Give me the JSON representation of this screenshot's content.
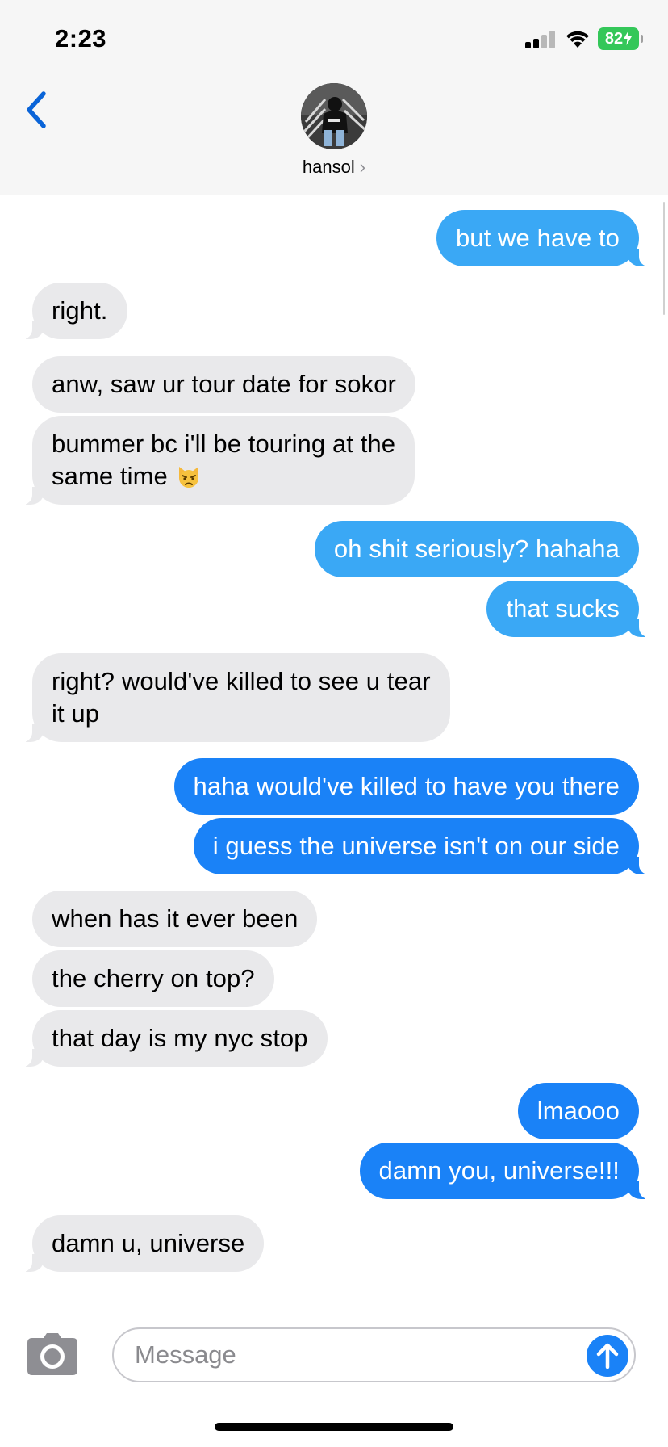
{
  "status_bar": {
    "time": "2:23",
    "battery": "82"
  },
  "header": {
    "back_icon": "chevron-left-icon",
    "contact_name": "hansol",
    "contact_chevron": "›"
  },
  "colors": {
    "incoming_bubble": "#e9e9eb",
    "outgoing_bubble_light": "#3aa8f5",
    "outgoing_bubble_dark": "#1a82f7",
    "accent": "#007aff",
    "battery": "#34c759"
  },
  "messages": [
    {
      "from": "me",
      "text": "but we have to",
      "tail": true
    },
    {
      "from": "them",
      "text": "right.",
      "tail": true
    },
    {
      "from": "them",
      "text": "anw, saw ur tour date for sokor",
      "tail": false
    },
    {
      "from": "them",
      "text": "bummer bc i'll be touring at the\nsame time",
      "emoji": "pouting-cat-emoji",
      "tail": true
    },
    {
      "from": "me",
      "text": "oh shit seriously? hahaha",
      "tail": false
    },
    {
      "from": "me",
      "text": "that sucks",
      "tail": true
    },
    {
      "from": "them",
      "text": "right? would've killed to see u tear\nit up",
      "tail": true
    },
    {
      "from": "me",
      "text": "haha would've killed to have you there",
      "tail": false
    },
    {
      "from": "me",
      "text": "i guess the universe isn't on our side",
      "tail": true
    },
    {
      "from": "them",
      "text": "when has it ever been",
      "tail": false
    },
    {
      "from": "them",
      "text": "the cherry on top?",
      "tail": false
    },
    {
      "from": "them",
      "text": "that day is my nyc stop",
      "tail": true
    },
    {
      "from": "me",
      "text": "lmaooo",
      "tail": false
    },
    {
      "from": "me",
      "text": "damn you, universe!!!",
      "tail": true
    },
    {
      "from": "them",
      "text": "damn u, universe",
      "tail": true
    }
  ],
  "composer": {
    "camera_icon": "camera-icon",
    "placeholder": "Message",
    "value": "",
    "send_icon": "arrow-up-icon"
  }
}
